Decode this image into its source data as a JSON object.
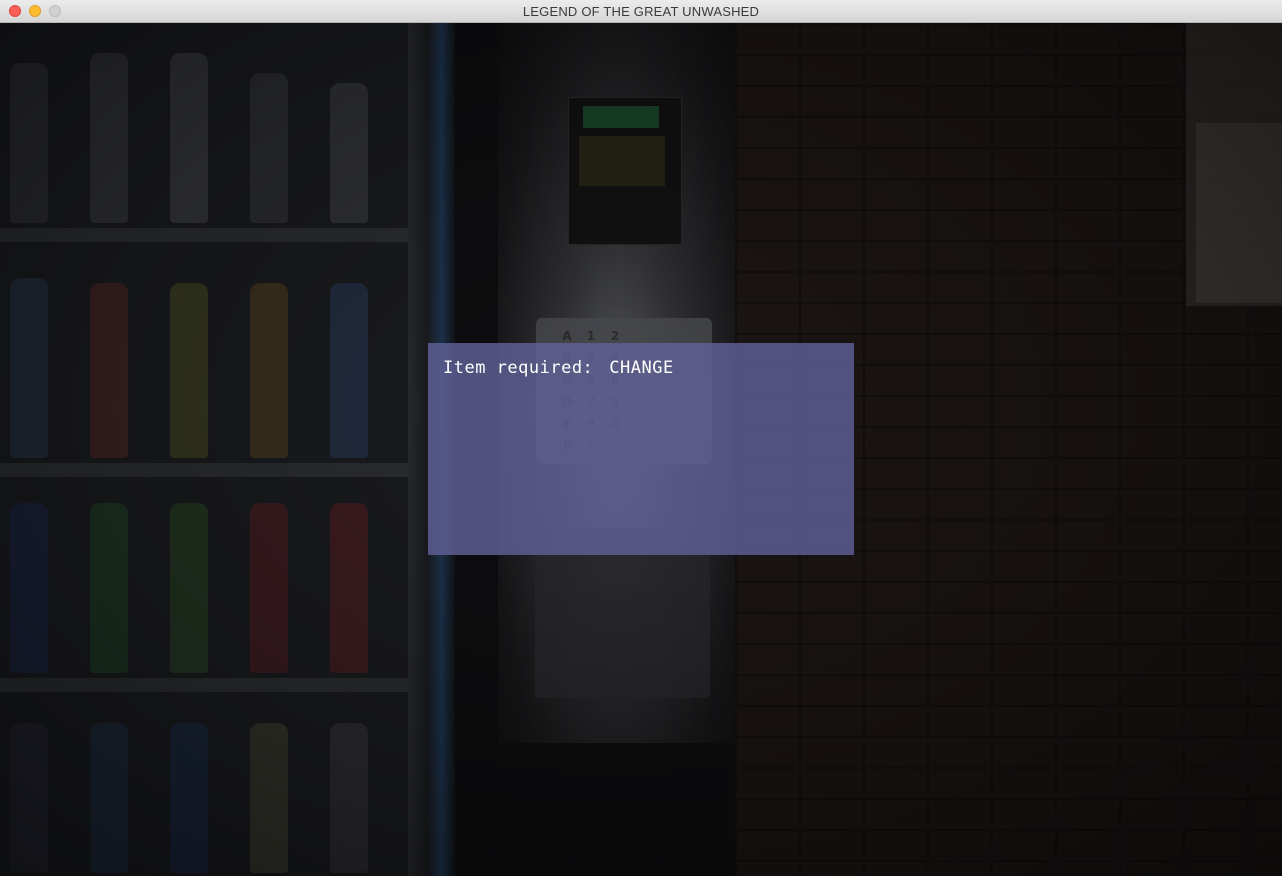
{
  "window": {
    "title": "LEGEND OF THE GREAT UNWASHED"
  },
  "scene": {
    "keypad_keys": [
      "A",
      "1",
      "2",
      "B",
      "3",
      "4",
      "C",
      "5",
      "6",
      "D",
      "7",
      "8",
      "E",
      "9",
      "0",
      "F",
      "*",
      "-"
    ]
  },
  "dialog": {
    "label": "Item required:",
    "item": "CHANGE"
  },
  "colors": {
    "dialog_background": "#6060a0",
    "dialog_text": "#ffffff"
  }
}
